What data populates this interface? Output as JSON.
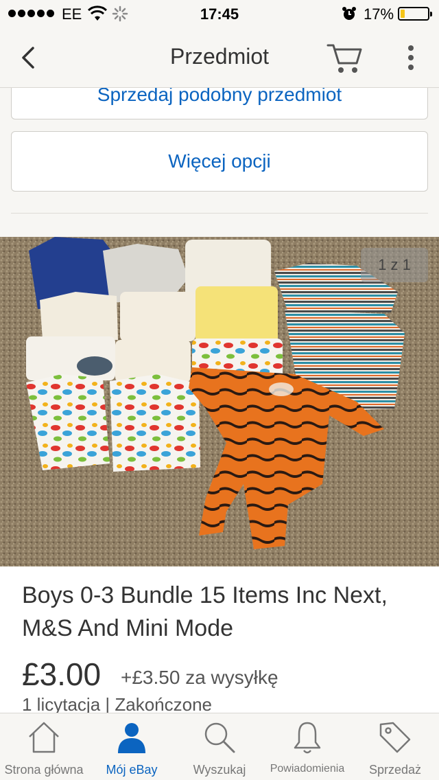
{
  "status_bar": {
    "carrier": "EE",
    "time": "17:45",
    "battery": "17%",
    "battery_level": 0.17
  },
  "nav": {
    "title": "Przedmiot",
    "back_icon": "chevron-left-icon",
    "cart_icon": "cart-icon",
    "more_icon": "more-vertical-icon"
  },
  "options": {
    "sell_similar": "Sprzedaj podobny przedmiot",
    "more_options": "Więcej opcji"
  },
  "photo": {
    "counter": "1 z 1"
  },
  "item": {
    "title": "Boys 0-3 Bundle 15 Items Inc Next, M&S And Mini Mode",
    "price": "£3.00",
    "shipping": "+£3.50 za wysyłkę",
    "bids": "1 licytacja  |  Zakończone"
  },
  "tabs": [
    {
      "label": "Strona główna",
      "icon": "home-icon"
    },
    {
      "label": "Mój eBay",
      "icon": "user-icon"
    },
    {
      "label": "Wyszukaj",
      "icon": "search-icon"
    },
    {
      "label": "Powiadomienia",
      "icon": "bell-icon"
    },
    {
      "label": "Sprzedaż",
      "icon": "tag-icon"
    }
  ],
  "colors": {
    "accent": "#0b64c0",
    "bar_bg": "#f7f6f3",
    "battery_fill": "#f5c518"
  }
}
